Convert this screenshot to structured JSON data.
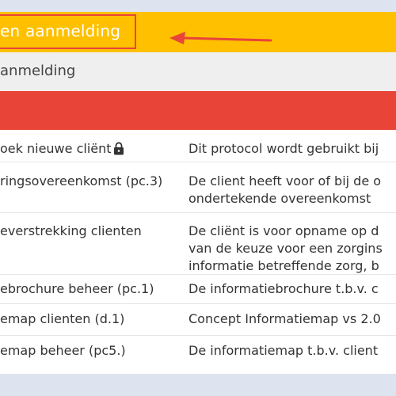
{
  "header": {
    "yellow_title": "en aanmelding",
    "gray_title": "anmelding"
  },
  "colors": {
    "accent_yellow": "#ffc000",
    "header_red": "#e84538",
    "annotation_red": "#e8443a"
  },
  "table": {
    "rows": [
      {
        "name": "oek nieuwe cliënt",
        "locked": true,
        "icon": "lock-icon",
        "description": "Dit protocol wordt gebruikt bij"
      },
      {
        "name": "ringsovereenkomst (pc.3)",
        "locked": false,
        "description": "De client heeft voor of bij de o\nondertekende overeenkomst"
      },
      {
        "name": "everstrekking clienten",
        "locked": false,
        "description": "De cliënt is voor opname op d\nvan de keuze voor een zorgins\ninformatie betreffende zorg, b"
      },
      {
        "name": "ebrochure beheer (pc.1)",
        "locked": false,
        "description": "De informatiebrochure t.b.v. c"
      },
      {
        "name": "emap clienten (d.1)",
        "locked": false,
        "description": "Concept Informatiemap vs 2.0"
      },
      {
        "name": "emap beheer (pc5.)",
        "locked": false,
        "description": "De informatiemap t.b.v. client"
      }
    ]
  }
}
